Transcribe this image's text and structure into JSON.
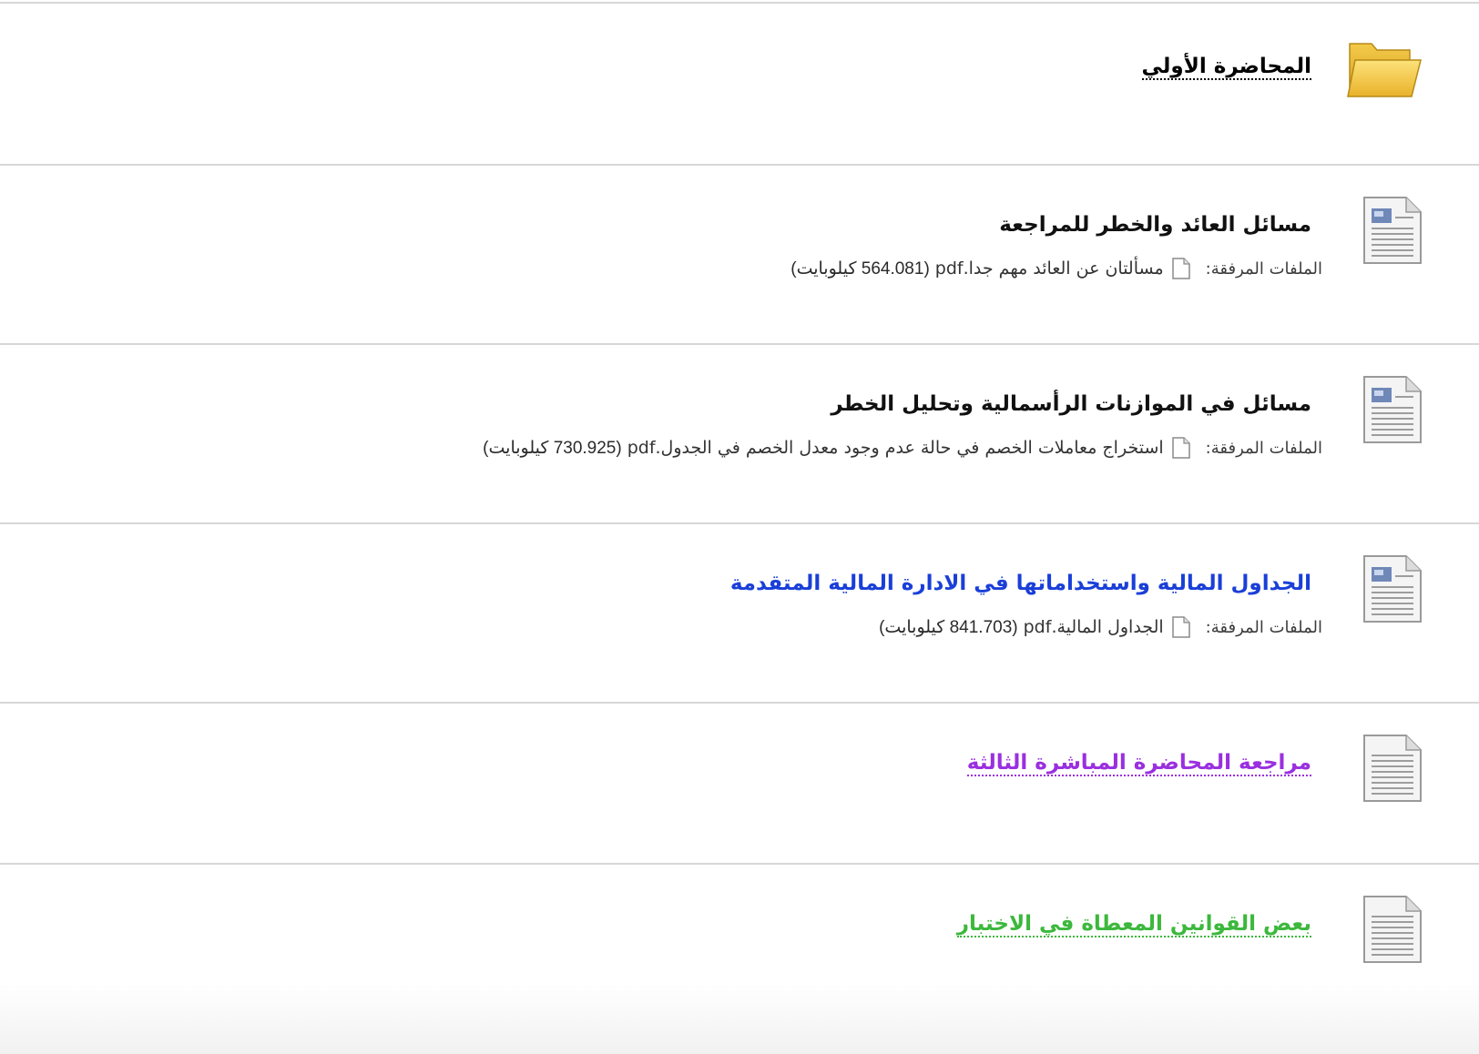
{
  "items": [
    {
      "type": "folder",
      "icon": "folder-icon",
      "title": "المحاضرة الأولي",
      "title_color": "#111111",
      "dotted": true
    },
    {
      "type": "document",
      "icon": "document-icon",
      "title": "مسائل العائد والخطر للمراجعة",
      "title_color": "#111111",
      "attachments_label": "الملفات المرفقة:",
      "file_icon": "file-icon",
      "file_name": "مسألتان عن العائد مهم جدا.pdf",
      "file_size": "(564.081 كيلوبايت)"
    },
    {
      "type": "document",
      "icon": "document-icon",
      "title": "مسائل في الموازنات الرأسمالية وتحليل الخطر",
      "title_color": "#111111",
      "attachments_label": "الملفات المرفقة:",
      "file_icon": "file-icon",
      "file_name": "استخراج معاملات الخصم في حالة عدم وجود معدل الخصم في الجدول.pdf",
      "file_size": "(730.925 كيلوبايت)"
    },
    {
      "type": "document",
      "icon": "document-icon",
      "title": "الجداول المالية واستخداماتها في الادارة المالية المتقدمة",
      "title_color": "#1a3fd8",
      "attachments_label": "الملفات المرفقة:",
      "file_icon": "file-icon",
      "file_name": "الجداول المالية.pdf",
      "file_size": "(841.703 كيلوبايت)"
    },
    {
      "type": "document",
      "icon": "document-icon",
      "title": "مراجعة المحاضرة المباشرة الثالثة",
      "title_color": "#9a2fe0",
      "dotted": true
    },
    {
      "type": "document",
      "icon": "document-icon",
      "title": "بعض القوانين المعطاة في الاختبار",
      "title_color": "#3cb83c",
      "dotted": true
    }
  ]
}
